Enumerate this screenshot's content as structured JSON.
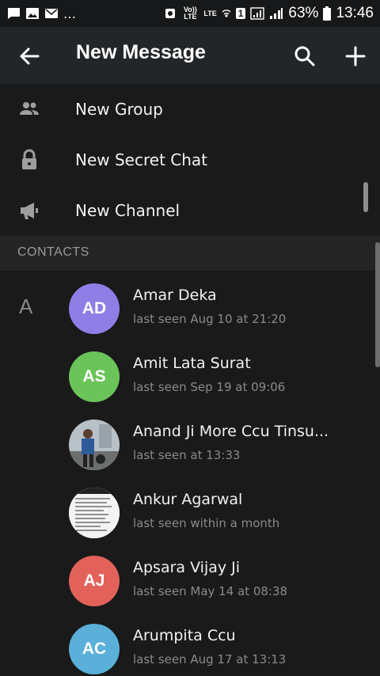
{
  "statusbar": {
    "battery": "63%",
    "time": "13:46",
    "network_label_1": "Vo)) LTE",
    "network_label_2": "LTE",
    "sim_label": "1"
  },
  "toolbar": {
    "title": "New Message",
    "back_icon": "arrow-left-icon",
    "search_icon": "search-icon",
    "add_icon": "plus-icon"
  },
  "actions": [
    {
      "label": "New Group",
      "icon": "group-icon"
    },
    {
      "label": "New Secret Chat",
      "icon": "lock-icon"
    },
    {
      "label": "New Channel",
      "icon": "megaphone-icon"
    }
  ],
  "section": {
    "label": "CONTACTS",
    "letter": "A"
  },
  "contacts": [
    {
      "name": "Amar Deka",
      "status": "last seen Aug 10 at 21:20",
      "initials": "AD",
      "color": "#8e7ee6"
    },
    {
      "name": "Amit Lata Surat",
      "status": "last seen Sep 19 at 09:06",
      "initials": "AS",
      "color": "#6bc45a"
    },
    {
      "name": "Anand Ji More Ccu Tinsu...",
      "status": "last seen at 13:33",
      "initials": "",
      "color": "#6a7a8c"
    },
    {
      "name": "Ankur Agarwal",
      "status": "last seen within a month",
      "initials": "",
      "color": "#f5f5f5"
    },
    {
      "name": "Apsara Vijay Ji",
      "status": "last seen May 14 at 08:38",
      "initials": "AJ",
      "color": "#e2625a"
    },
    {
      "name": "Arumpita Ccu",
      "status": "last seen Aug 17 at 13:13",
      "initials": "AC",
      "color": "#5ab0d8"
    }
  ]
}
